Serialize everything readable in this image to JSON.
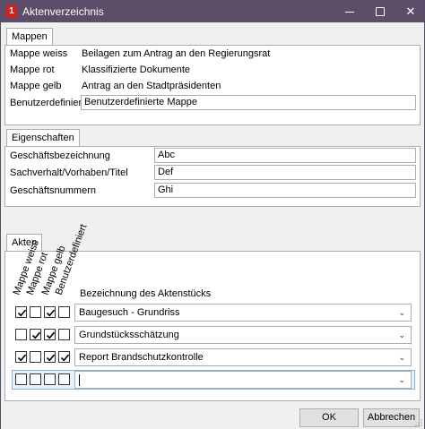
{
  "window": {
    "title": "Aktenverzeichnis",
    "icon_char": "1",
    "min_icon": "minimize-icon",
    "max_icon": "maximize-icon",
    "close_icon": "close-icon",
    "close_glyph": "✕"
  },
  "mappen": {
    "tab_label": "Mappen",
    "rows": [
      {
        "label": "Mappe weiss",
        "value": "Beilagen zum Antrag an den Regierungsrat"
      },
      {
        "label": "Mappe rot",
        "value": "Klassifizierte Dokumente"
      },
      {
        "label": "Mappe gelb",
        "value": "Antrag an den Stadtpräsidenten"
      },
      {
        "label": "Benutzerdefiniert",
        "value": "Benutzerdefinierte Mappe"
      }
    ]
  },
  "eigenschaften": {
    "tab_label": "Eigenschaften",
    "rows": [
      {
        "label": "Geschäftsbezeichnung",
        "value": "Abc"
      },
      {
        "label": "Sachverhalt/Vorhaben/Titel",
        "value": "Def"
      },
      {
        "label": "Geschäftsnummern",
        "value": "Ghi"
      }
    ]
  },
  "akten": {
    "tab_label": "Akten",
    "column_headers": [
      "Mappe weiss",
      "Mappe rot",
      "Mappe gelb",
      "Benutzerdefiniert"
    ],
    "name_header": "Bezeichnung des Aktenstücks",
    "rows": [
      {
        "checks": [
          true,
          false,
          true,
          false
        ],
        "name": "Baugesuch - Grundriss"
      },
      {
        "checks": [
          false,
          true,
          true,
          false
        ],
        "name": "Grundstücksschätzung"
      },
      {
        "checks": [
          true,
          false,
          true,
          true
        ],
        "name": "Report Brandschutzkontrolle"
      },
      {
        "checks": [
          false,
          false,
          false,
          false
        ],
        "name": ""
      }
    ],
    "dropdown_icon": "chevron-down-icon",
    "dropdown_glyph": "⌄"
  },
  "footer": {
    "ok_label": "OK",
    "cancel_label": "Abbrechen"
  }
}
